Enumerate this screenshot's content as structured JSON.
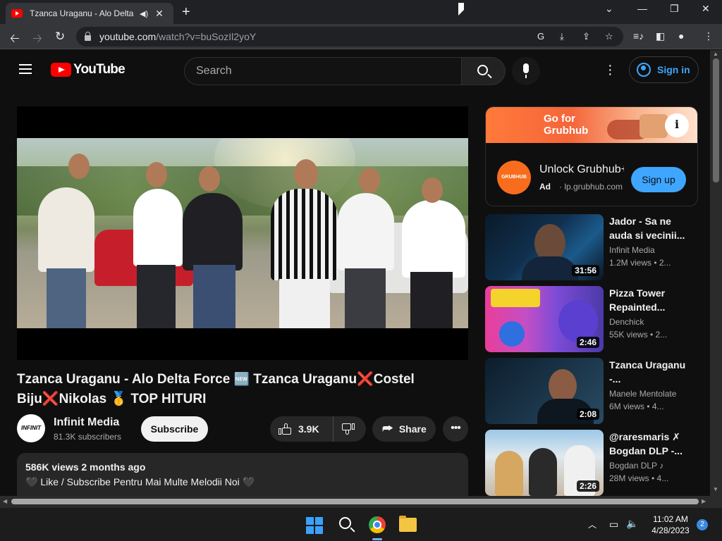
{
  "browser": {
    "tab_title": "Tzanca Uraganu - Alo Delta Force",
    "tab_audio_icon": "speaker-icon",
    "new_tab_label": "+",
    "url_host": "youtube.com",
    "url_path": "/watch?v=buSozIl2yoY"
  },
  "yt_header": {
    "logo_text": "YouTube",
    "search_placeholder": "Search",
    "signin_label": "Sign in"
  },
  "video": {
    "title_part1": "Tzanca Uraganu - Alo Delta Force ",
    "title_badge": "🆕",
    "title_part2": " Tzanca Uraganu",
    "title_x1": "❌",
    "title_part3": "Costel Biju",
    "title_x2": "❌",
    "title_part4": "Nikolas ",
    "title_medal": "🥇",
    "title_part5": " TOP HITURI",
    "channel_name": "Infinit Media",
    "channel_avatar_text": "INFINIT",
    "subscribers": "81.3K subscribers",
    "subscribe_label": "Subscribe",
    "like_count": "3.9K",
    "share_label": "Share",
    "more_label": "•••"
  },
  "description": {
    "meta": "586K views  2 months ago",
    "line1": "🖤 Like / Subscribe Pentru Mai Multe Melodii Noi 🖤"
  },
  "ad": {
    "banner_text": "Go for Grubhub",
    "logo_text": "GRUBHUB",
    "title": "Unlock Grubhub+",
    "badge": "Ad",
    "domain": "· lp.grubhub.com",
    "cta": "Sign up",
    "info_label": "i"
  },
  "recommendations": [
    {
      "title": "Jador - Sa ne auda si vecinii...",
      "channel": "Infinit Media",
      "views": "1.2M views  • 2...",
      "duration": "31:56"
    },
    {
      "title": "Pizza Tower Repainted...",
      "channel": "Denchick",
      "views": "55K views  • 2...",
      "duration": "2:46"
    },
    {
      "title": "Tzanca Uraganu -...",
      "channel": "Manele Mentolate",
      "views": "6M views  • 4...",
      "duration": "2:08"
    },
    {
      "title": "@raresmaris ✗ Bogdan DLP -...",
      "channel": "Bogdan DLP ♪",
      "views": "28M views  • 4...",
      "duration": "2:26"
    }
  ],
  "taskbar": {
    "time": "11:02 AM",
    "date": "4/28/2023",
    "notification_count": "2"
  }
}
